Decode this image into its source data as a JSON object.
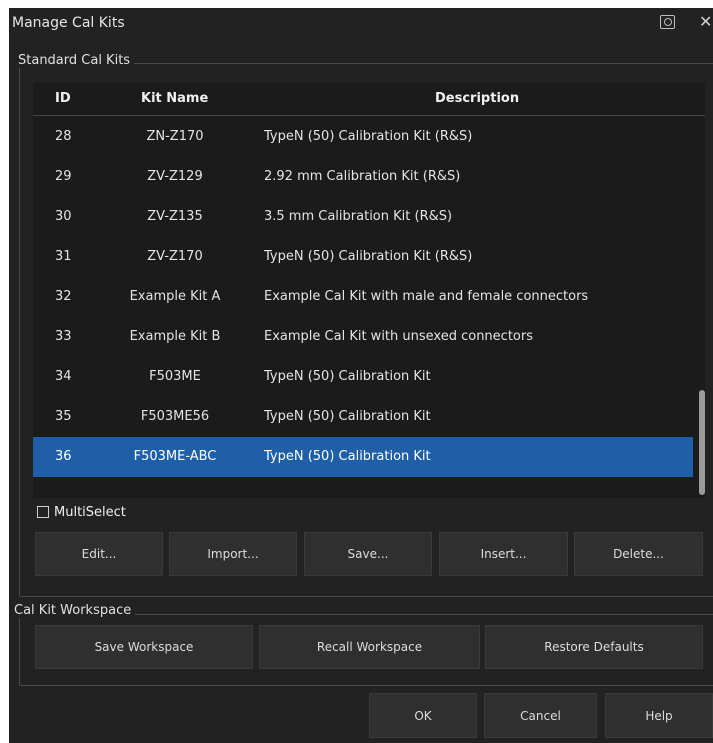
{
  "window": {
    "title": "Manage Cal Kits",
    "close_glyph": "✕"
  },
  "standard_group": {
    "label": "Standard Cal Kits",
    "columns": [
      "ID",
      "Kit Name",
      "Description"
    ],
    "rows": [
      {
        "id": "28",
        "name": "ZN-Z170",
        "desc": "TypeN (50) Calibration Kit (R&S)"
      },
      {
        "id": "29",
        "name": "ZV-Z129",
        "desc": "2.92 mm Calibration Kit (R&S)"
      },
      {
        "id": "30",
        "name": "ZV-Z135",
        "desc": "3.5 mm Calibration Kit (R&S)"
      },
      {
        "id": "31",
        "name": "ZV-Z170",
        "desc": "TypeN (50) Calibration Kit (R&S)"
      },
      {
        "id": "32",
        "name": "Example Kit A",
        "desc": "Example Cal Kit with male and female connectors"
      },
      {
        "id": "33",
        "name": "Example Kit B",
        "desc": "Example Cal Kit with unsexed connectors"
      },
      {
        "id": "34",
        "name": "F503ME",
        "desc": "TypeN (50) Calibration Kit"
      },
      {
        "id": "35",
        "name": "F503ME56",
        "desc": "TypeN (50) Calibration Kit"
      },
      {
        "id": "36",
        "name": "F503ME-ABC",
        "desc": "TypeN (50) Calibration Kit"
      }
    ],
    "selected_row_index": 8,
    "multiselect_label": "MultiSelect",
    "buttons": {
      "edit": "Edit...",
      "import": "Import...",
      "save": "Save...",
      "insert": "Insert...",
      "delete": "Delete..."
    }
  },
  "workspace_group": {
    "label": "Cal Kit Workspace",
    "buttons": {
      "save": "Save Workspace",
      "recall": "Recall Workspace",
      "restore": "Restore Defaults"
    }
  },
  "footer": {
    "ok": "OK",
    "cancel": "Cancel",
    "help": "Help"
  },
  "colors": {
    "dialog_bg": "#222222",
    "table_bg": "#1b1b1b",
    "selection": "#1f5fa8",
    "button_bg": "#2f2f2f"
  }
}
